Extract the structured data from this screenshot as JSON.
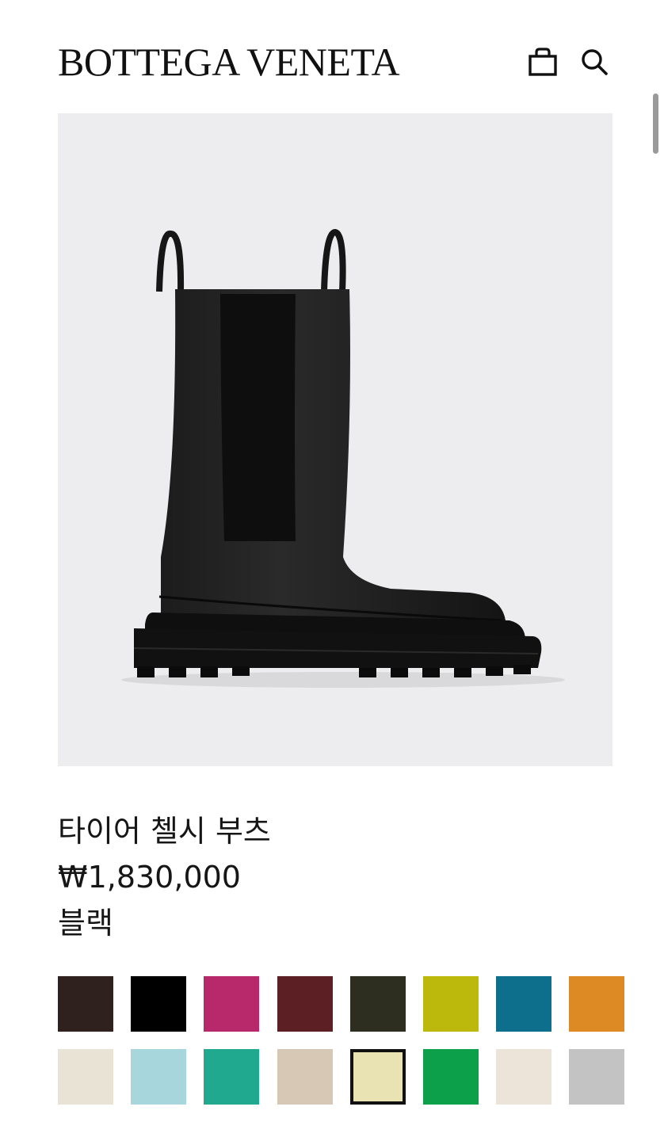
{
  "header": {
    "brand": "BOTTEGA VENETA",
    "bag_icon": "shopping-bag-icon",
    "search_icon": "search-icon"
  },
  "product": {
    "name": "타이어 첼시 부츠",
    "price": "₩1,830,000",
    "color": "블랙"
  },
  "swatches": [
    {
      "color": "#2e211e"
    },
    {
      "color": "#000000"
    },
    {
      "color": "#b8296b"
    },
    {
      "color": "#5c1f24"
    },
    {
      "color": "#2d2e1f"
    },
    {
      "color": "#bdb80c"
    },
    {
      "color": "#0e6f8c"
    },
    {
      "color": "#dd8a24"
    },
    {
      "color": "#e9e3d6"
    },
    {
      "color": "#a7d6dc"
    },
    {
      "color": "#21a98f"
    },
    {
      "color": "#d6c8b5"
    },
    {
      "color": "#e9e3b3",
      "selected": true
    },
    {
      "color": "#0ca04a"
    },
    {
      "color": "#ece4d8"
    },
    {
      "color": "#c3c3c3"
    }
  ]
}
